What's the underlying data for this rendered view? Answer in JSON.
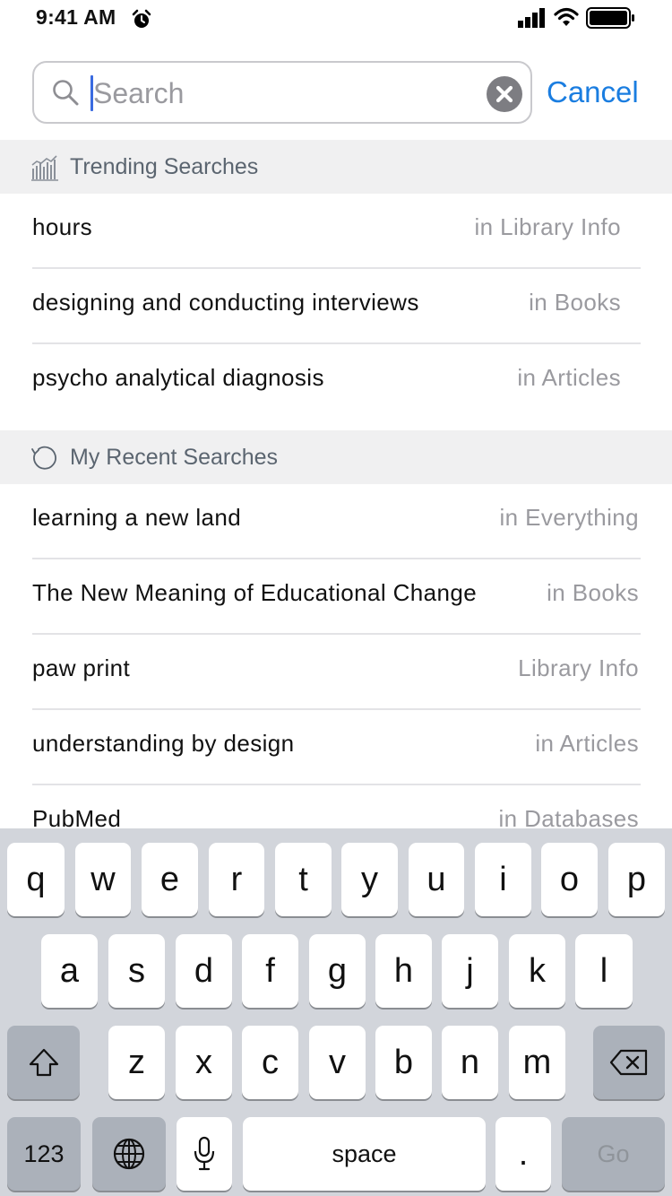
{
  "status_bar": {
    "time": "9:41 AM"
  },
  "search": {
    "placeholder": "Search",
    "value": "",
    "cancel_label": "Cancel"
  },
  "trending": {
    "title": "Trending Searches",
    "items": [
      {
        "term": "hours",
        "scope": "in Library Info"
      },
      {
        "term": "designing and conducting interviews",
        "scope": "in Books"
      },
      {
        "term": "psycho analytical diagnosis",
        "scope": "in Articles"
      }
    ]
  },
  "recent": {
    "title": "My Recent Searches",
    "items": [
      {
        "term": "learning a new land",
        "scope": "in Everything"
      },
      {
        "term": "The New Meaning of Educational Change",
        "scope": "in Books"
      },
      {
        "term": "paw print",
        "scope": "Library Info"
      },
      {
        "term": "understanding by design",
        "scope": "in Articles"
      },
      {
        "term": "PubMed",
        "scope": "in Databases"
      }
    ]
  },
  "keyboard": {
    "row1": [
      "q",
      "w",
      "e",
      "r",
      "t",
      "y",
      "u",
      "i",
      "o",
      "p"
    ],
    "row2": [
      "a",
      "s",
      "d",
      "f",
      "g",
      "h",
      "j",
      "k",
      "l"
    ],
    "row3": [
      "z",
      "x",
      "c",
      "v",
      "b",
      "n",
      "m"
    ],
    "numbers_label": "123",
    "space_label": "space",
    "period_label": ".",
    "go_label": "Go"
  },
  "icons": {
    "alarm": "alarm-icon",
    "signal": "signal-icon",
    "wifi": "wifi-icon",
    "battery": "battery-icon",
    "search": "search-icon",
    "clear": "clear-icon",
    "trending": "trending-chart-icon",
    "recent": "history-icon",
    "shift": "shift-icon",
    "delete": "backspace-icon",
    "globe": "globe-icon",
    "mic": "microphone-icon"
  },
  "colors": {
    "accent": "#1a7de0",
    "caret": "#3a6be0",
    "header_bg": "#f0f0f1",
    "keyboard_bg": "#d2d5db"
  }
}
